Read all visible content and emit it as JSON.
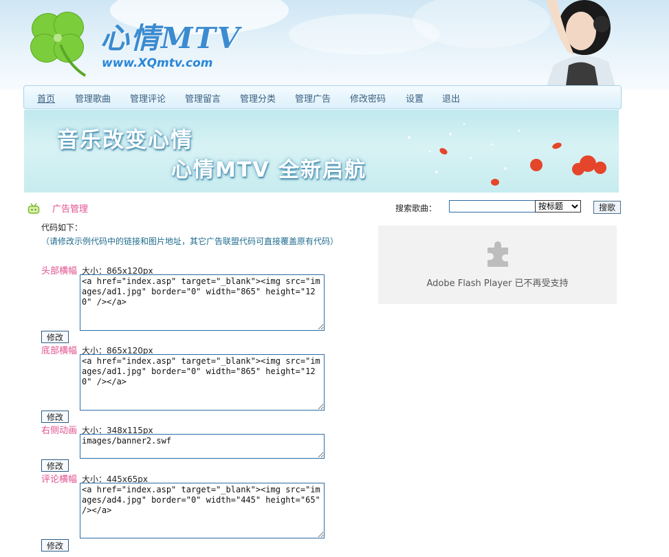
{
  "header": {
    "site_title": "心情MTV",
    "site_url": "www.XQmtv.com"
  },
  "nav": {
    "items": [
      {
        "label": "首页"
      },
      {
        "label": "管理歌曲"
      },
      {
        "label": "管理评论"
      },
      {
        "label": "管理留言"
      },
      {
        "label": "管理分类"
      },
      {
        "label": "管理广告"
      },
      {
        "label": "修改密码"
      },
      {
        "label": "设置"
      },
      {
        "label": "退出"
      }
    ]
  },
  "banner": {
    "line1": "音乐改变心情",
    "line2": "心情MTV 全新启航"
  },
  "section": {
    "title": "广告管理"
  },
  "search": {
    "label": "搜索歌曲：",
    "value": "",
    "select_value": "按标题",
    "button_label": "搜歌"
  },
  "flash": {
    "message": "Adobe Flash Player 已不再受支持"
  },
  "code_intro": "代码如下：",
  "code_note": "（请修改示例代码中的链接和图片地址，其它广告联盟代码可直接覆盖原有代码）",
  "ads": [
    {
      "label": "头部横幅",
      "size": "大小：865x120px",
      "code": "<a href=\"index.asp\" target=\"_blank\"><img src=\"images/ad1.jpg\" border=\"0\" width=\"865\" height=\"120\" /></a>",
      "button": "修改"
    },
    {
      "label": "底部横幅",
      "size": "大小：865x120px",
      "code": "<a href=\"index.asp\" target=\"_blank\"><img src=\"images/ad1.jpg\" border=\"0\" width=\"865\" height=\"120\" /></a>",
      "button": "修改"
    },
    {
      "label": "右侧动画",
      "size": "大小：348x115px",
      "code": "images/banner2.swf",
      "button": "修改"
    },
    {
      "label": "评论横幅",
      "size": "大小：445x65px",
      "code": "<a href=\"index.asp\" target=\"_blank\"><img src=\"images/ad4.jpg\" border=\"0\" width=\"445\" height=\"65\" /></a>",
      "button": "修改"
    }
  ],
  "colors": {
    "accent_pink": "#e0518d",
    "nav_text": "#3b5e80",
    "link_blue": "#2a86d6"
  }
}
